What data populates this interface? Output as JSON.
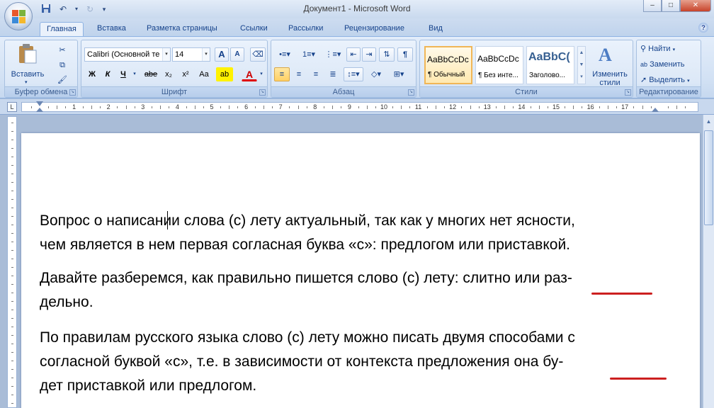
{
  "window": {
    "title": "Документ1 - Microsoft Word",
    "minimize": "–",
    "maximize": "□",
    "close": "✕"
  },
  "tabs": [
    "Главная",
    "Вставка",
    "Разметка страницы",
    "Ссылки",
    "Рассылки",
    "Рецензирование",
    "Вид"
  ],
  "ribbon": {
    "clipboard": {
      "label": "Буфер обмена",
      "paste": "Вставить"
    },
    "font": {
      "label": "Шрифт",
      "font_name": "Calibri (Основной те",
      "font_size": "14",
      "grow": "A",
      "shrink": "A",
      "bold": "Ж",
      "italic": "К",
      "underline": "Ч",
      "strike": "abe",
      "subscript": "x₂",
      "superscript": "x²",
      "change_case": "Aa",
      "highlight": "ab",
      "font_color": "A"
    },
    "paragraph": {
      "label": "Абзац",
      "pilcrow": "¶"
    },
    "styles": {
      "label": "Стили",
      "items": [
        {
          "sample": "AaBbCcDc",
          "name": "¶ Обычный"
        },
        {
          "sample": "AaBbCcDc",
          "name": "¶ Без инте..."
        },
        {
          "sample": "AaBbC(",
          "name": "Заголово..."
        }
      ],
      "change_styles": "Изменить стили"
    },
    "editing": {
      "label": "Редактирование",
      "find": "Найти",
      "replace": "Заменить",
      "select": "Выделить"
    }
  },
  "ruler": {
    "numbers": [
      "1",
      "1",
      "2",
      "3",
      "4",
      "5",
      "6",
      "7",
      "8",
      "9",
      "10",
      "11",
      "12",
      "13",
      "14",
      "15",
      "16",
      "17"
    ]
  },
  "document": {
    "paragraphs": [
      [
        "Вопрос о написании слова (с) лету актуальный, так как у многих нет ясности,",
        "чем является в нем первая согласная буква «с»: предлогом или приставкой."
      ],
      [
        "Давайте разберемся, как правильно пишется слово (с) лету: слитно или раз-",
        "дельно."
      ],
      [
        "По правилам русского языка слово (с) лету можно писать двумя способами с",
        "согласной буквой «с», т.е. в зависимости от контекста предложения она бу-",
        "дет приставкой или предлогом."
      ]
    ]
  },
  "colors": {
    "accent": "#15428b",
    "spell_underline": "#cc1f1f",
    "selected_style": "#f0b657"
  }
}
